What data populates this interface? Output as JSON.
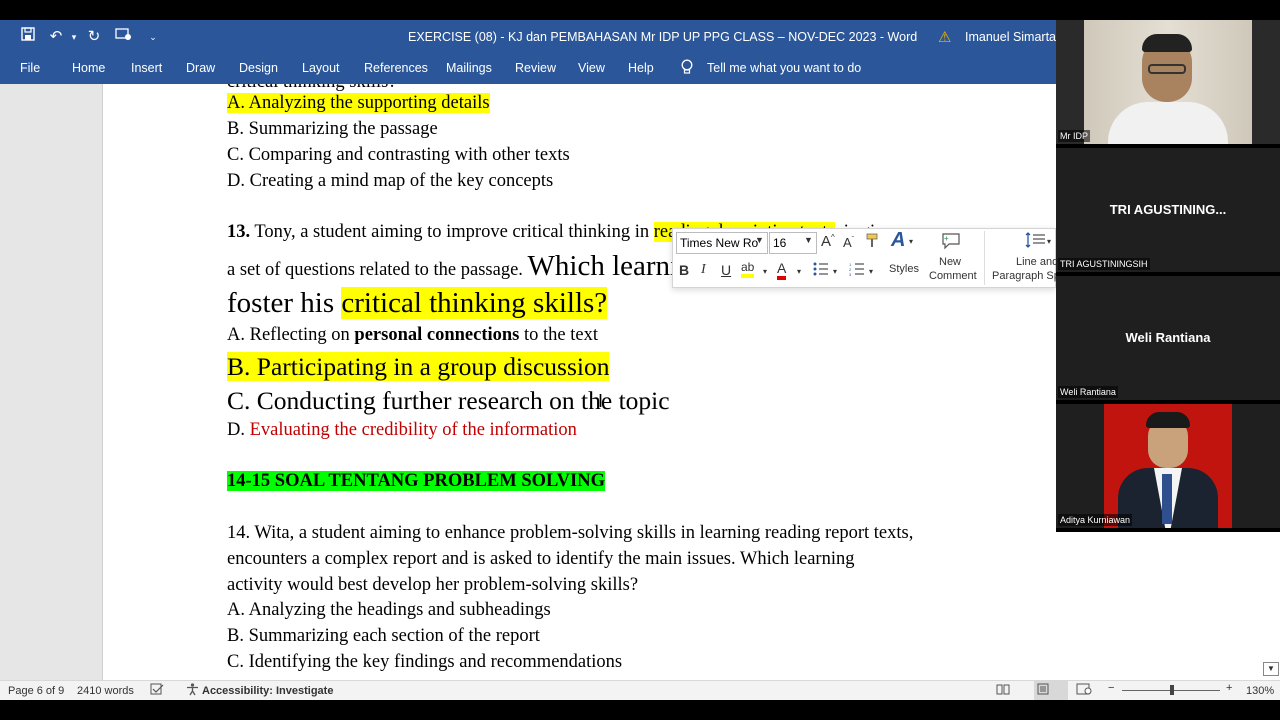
{
  "window": {
    "title": "EXERCISE (08) - KJ dan PEMBAHASAN Mr IDP UP PPG CLASS – NOV-DEC 2023  -  Word",
    "user": "Imanuel Simarta"
  },
  "menu": {
    "items": [
      "File",
      "Home",
      "Insert",
      "Draw",
      "Design",
      "Layout",
      "References",
      "Mailings",
      "Review",
      "View",
      "Help"
    ],
    "tell_me": "Tell me what you want to do"
  },
  "document": {
    "cut_line": "critical thinking skills?",
    "q12_a": "A. Analyzing the supporting details",
    "q12_b": "B. Summarizing the passage",
    "q12_c": "C. Comparing and contrasting with other texts",
    "q12_d": "D. Creating a mind map of the key concepts",
    "q13_num": "13.",
    "q13_p1": " Tony, a student aiming to improve critical thinking in ",
    "q13_hl1": "reading descriptive texts",
    "q13_p2": ", is given",
    "q13_l2a": "a set of questions related to the passage. ",
    "q13_l2b": "Which learning activity would best",
    "q13_l3a": "foster his ",
    "q13_l3b": "critical thinking skills?",
    "q13_a_pre": "A. Reflecting on ",
    "q13_a_bold": "personal connections",
    "q13_a_post": " to the text",
    "q13_b": "B. Participating in a group discussion",
    "q13_c": "C. Conducting further research on the topic",
    "q13_d_pre": "D. ",
    "q13_d_red": "Evaluating the credibility of the information",
    "section_heading": "14-15 SOAL TENTANG PROBLEM SOLVING",
    "q14_l1": "14. Wita, a student aiming to enhance problem-solving skills in learning reading report texts,",
    "q14_l2": "encounters a complex report and is asked to identify the main issues. Which learning",
    "q14_l3": "activity would best develop her problem-solving skills?",
    "q14_a": "A. Analyzing the headings and subheadings",
    "q14_b": "B. Summarizing each section of the report",
    "q14_c": "C. Identifying the key findings and recommendations"
  },
  "mini_toolbar": {
    "font": "Times New Ro",
    "size": "16",
    "styles": "Styles",
    "new_comment_1": "New",
    "new_comment_2": "Comment",
    "line_para_1": "Line and",
    "line_para_2": "Paragraph Spacing"
  },
  "status": {
    "page": "Page 6 of 9",
    "words": "2410 words",
    "accessibility": "Accessibility: Investigate",
    "zoom": "130%"
  },
  "participants": [
    {
      "label": "Mr IDP",
      "display": ""
    },
    {
      "label": "TRI AGUSTININGSIH",
      "display": "TRI  AGUSTINING..."
    },
    {
      "label": "Weli Rantiana",
      "display": "Weli Rantiana"
    },
    {
      "label": "Aditya Kurniawan",
      "display": ""
    }
  ],
  "colors": {
    "word_blue": "#2b579a",
    "highlight_yellow": "#ffff00",
    "highlight_green": "#00ff00",
    "answer_red": "#c00000"
  }
}
